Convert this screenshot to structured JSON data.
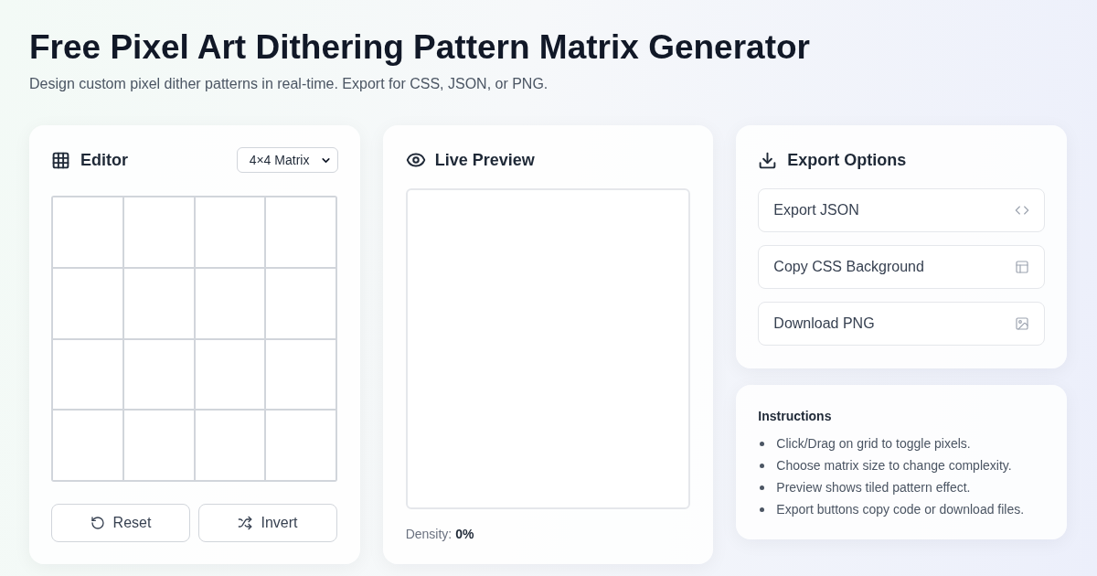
{
  "page": {
    "title": "Free Pixel Art Dithering Pattern Matrix Generator",
    "subtitle": "Design custom pixel dither patterns in real-time. Export for CSS, JSON, or PNG."
  },
  "editor": {
    "title": "Editor",
    "matrix_select": {
      "value": "4×4 Matrix"
    },
    "grid": [
      [
        {
          "on": false
        },
        {
          "on": false
        },
        {
          "on": false
        },
        {
          "on": false
        }
      ],
      [
        {
          "on": false
        },
        {
          "on": false
        },
        {
          "on": false
        },
        {
          "on": false
        }
      ],
      [
        {
          "on": false
        },
        {
          "on": false
        },
        {
          "on": false
        },
        {
          "on": false
        }
      ],
      [
        {
          "on": false
        },
        {
          "on": false
        },
        {
          "on": false
        },
        {
          "on": false
        }
      ]
    ],
    "buttons": [
      {
        "label": "Reset",
        "kind": "reset"
      },
      {
        "label": "Invert",
        "kind": "invert"
      }
    ]
  },
  "preview": {
    "title": "Live Preview",
    "density": "Density: **0%**"
  },
  "export": {
    "title": "Export Options",
    "buttons": [
      {
        "label": "Export JSON",
        "kind": "json"
      },
      {
        "label": "Copy CSS Background",
        "kind": "css"
      },
      {
        "label": "Download PNG",
        "kind": "png"
      }
    ]
  },
  "instructions": {
    "title": "Instructions",
    "items": [
      "Click/Drag on grid to toggle pixels.",
      "Choose matrix size to change complexity.",
      "Preview shows tiled pattern effect.",
      "Export buttons copy code or download files."
    ]
  }
}
